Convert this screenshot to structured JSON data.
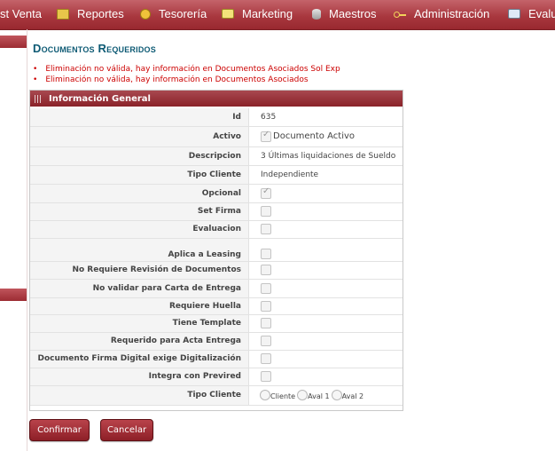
{
  "menu": {
    "items": [
      {
        "label": "st Venta",
        "icon": null
      },
      {
        "label": "Reportes",
        "icon": "folder-icon"
      },
      {
        "label": "Tesorería",
        "icon": "coin-icon"
      },
      {
        "label": "Marketing",
        "icon": "monitor-icon"
      },
      {
        "label": "Maestros",
        "icon": "database-icon"
      },
      {
        "label": "Administración",
        "icon": "key-icon"
      },
      {
        "label": "Evalu",
        "icon": "evaluation-icon"
      }
    ]
  },
  "page": {
    "title": "Documentos Requeridos",
    "errors": [
      "Eliminación no válida, hay información en Documentos Asociados Sol Exp",
      "Eliminación no válida, hay información en Documentos Asociados"
    ]
  },
  "panel": {
    "title": "Información General",
    "fields": {
      "id": {
        "label": "Id",
        "value": "635"
      },
      "activo": {
        "label": "Activo",
        "checked": true,
        "text": "Documento Activo"
      },
      "descripcion": {
        "label": "Descripcion",
        "value": "3 Últimas liquidaciones de Sueldo"
      },
      "tipo_cliente": {
        "label": "Tipo Cliente",
        "value": "Independiente"
      },
      "opcional": {
        "label": "Opcional",
        "checked": true
      },
      "set_firma": {
        "label": "Set Firma",
        "checked": false
      },
      "evaluacion": {
        "label": "Evaluacion",
        "checked": false
      },
      "aplica_leasing": {
        "label": "Aplica a Leasing",
        "checked": false
      },
      "no_requiere_revision": {
        "label": "No Requiere Revisión de Documentos",
        "checked": false
      },
      "no_validar_carta": {
        "label": "No validar para Carta de Entrega",
        "checked": false
      },
      "requiere_huella": {
        "label": "Requiere Huella",
        "checked": false
      },
      "tiene_template": {
        "label": "Tiene Template",
        "checked": false
      },
      "requerido_acta": {
        "label": "Requerido para Acta Entrega",
        "checked": false
      },
      "firma_digital": {
        "label": "Documento Firma Digital exige Digitalización",
        "checked": false
      },
      "integra_previred": {
        "label": "Integra con Previred",
        "checked": false
      },
      "tipo_cliente_radio": {
        "label": "Tipo Cliente",
        "options": [
          "Cliente",
          "Aval 1",
          "Aval 2"
        ]
      }
    }
  },
  "actions": {
    "confirm_label": "Confirmar",
    "cancel_label": "Cancelar"
  },
  "colors": {
    "menu_bar": "#a9383f",
    "title": "#0d5a74",
    "error": "#cc0000",
    "button": "#9c2c33"
  }
}
